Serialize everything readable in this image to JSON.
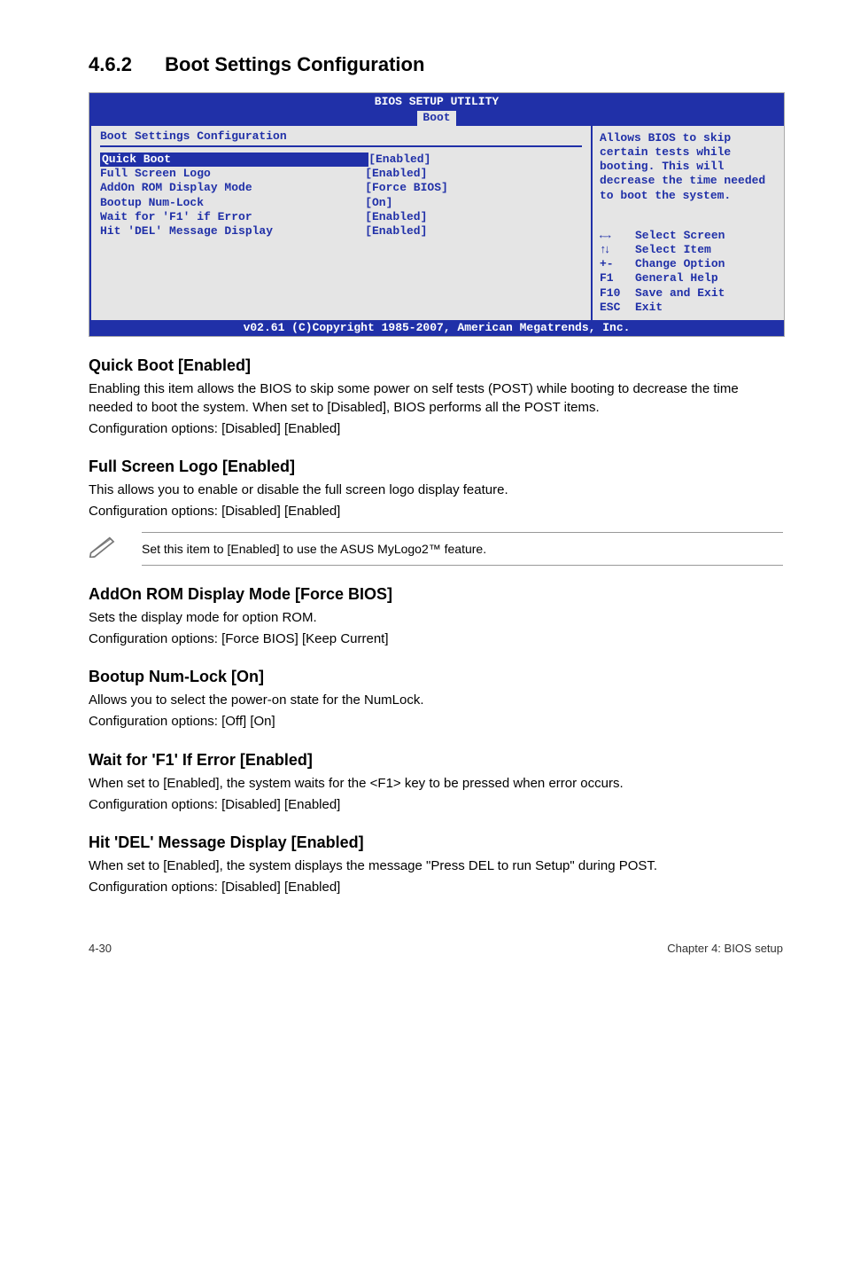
{
  "section": {
    "number": "4.6.2",
    "title": "Boot Settings Configuration"
  },
  "bios": {
    "header_title": "BIOS SETUP UTILITY",
    "tab": "Boot",
    "panel_heading": "Boot Settings Configuration",
    "rows": [
      {
        "label": "Quick Boot",
        "value": "[Enabled]",
        "selected": true
      },
      {
        "label": "Full Screen Logo",
        "value": "[Enabled]"
      },
      {
        "label": "AddOn ROM Display Mode",
        "value": "[Force BIOS]"
      },
      {
        "label": "Bootup Num-Lock",
        "value": "[On]"
      },
      {
        "label": "Wait for 'F1' if Error",
        "value": "[Enabled]"
      },
      {
        "label": "Hit 'DEL' Message Display",
        "value": "[Enabled]"
      }
    ],
    "help_text": "Allows BIOS to skip certain tests while booting. This will decrease the time needed to boot the system.",
    "legend": [
      {
        "key": "←→",
        "text": "Select Screen"
      },
      {
        "key": "↑↓",
        "text": "Select Item"
      },
      {
        "key": "+-",
        "text": "Change Option"
      },
      {
        "key": "F1",
        "text": "General Help"
      },
      {
        "key": "F10",
        "text": "Save and Exit"
      },
      {
        "key": "ESC",
        "text": "Exit"
      }
    ],
    "footer": "v02.61 (C)Copyright 1985-2007, American Megatrends, Inc."
  },
  "subs": {
    "quickboot": {
      "heading": "Quick Boot [Enabled]",
      "p1": "Enabling this item allows the BIOS to skip some power on self tests (POST) while booting to decrease the time needed to boot the system. When set to [Disabled], BIOS performs all the POST items.",
      "p2": "Configuration options: [Disabled] [Enabled]"
    },
    "fullscreen": {
      "heading": "Full Screen Logo [Enabled]",
      "p1": "This allows you to enable or disable the full screen logo display feature.",
      "p2": "Configuration options: [Disabled] [Enabled]"
    },
    "note": "Set this item to [Enabled] to use the ASUS MyLogo2™ feature.",
    "addon": {
      "heading": "AddOn ROM Display Mode [Force BIOS]",
      "p1": "Sets the display mode for option ROM.",
      "p2": "Configuration options: [Force BIOS] [Keep Current]"
    },
    "numlock": {
      "heading": "Bootup Num-Lock [On]",
      "p1": "Allows you to select the power-on state for the NumLock.",
      "p2": "Configuration options: [Off] [On]"
    },
    "waitf1": {
      "heading": "Wait for 'F1' If Error [Enabled]",
      "p1": "When set to [Enabled], the system waits for the <F1> key to be pressed when error occurs.",
      "p2": "Configuration options: [Disabled] [Enabled]"
    },
    "hitdel": {
      "heading": "Hit 'DEL' Message Display [Enabled]",
      "p1": "When set to [Enabled], the system displays the message \"Press DEL to run Setup\" during POST.",
      "p2": "Configuration options: [Disabled] [Enabled]"
    }
  },
  "footer": {
    "left": "4-30",
    "right": "Chapter 4: BIOS setup"
  }
}
